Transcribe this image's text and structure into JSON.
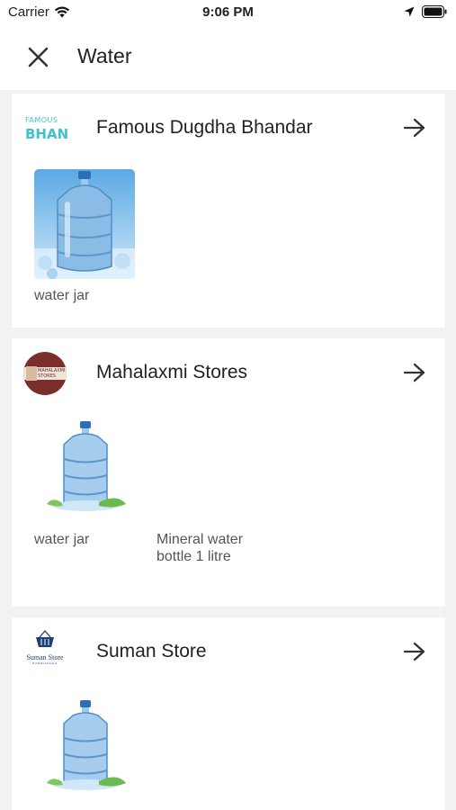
{
  "status_bar": {
    "carrier": "Carrier",
    "time": "9:06 PM"
  },
  "header": {
    "title": "Water"
  },
  "stores": [
    {
      "name": "Famous Dugdha Bhandar",
      "logo": {
        "line1": "FAMOUS",
        "line2": "BHAN"
      },
      "products": [
        {
          "name": "water jar"
        }
      ]
    },
    {
      "name": "Mahalaxmi Stores",
      "logo": {
        "line1": "MAHALAXMI",
        "line2": "STORES"
      },
      "products": [
        {
          "name": "water jar"
        },
        {
          "name": "Mineral water bottle 1 litre"
        }
      ]
    },
    {
      "name": "Suman Store",
      "logo": {
        "line1": "Suman Store",
        "line2": "DARBHANGA"
      },
      "products": [
        {
          "name": ""
        }
      ]
    }
  ],
  "icons": {
    "close": "close-icon",
    "arrow": "arrow-right-icon",
    "wifi": "wifi-icon",
    "location": "location-arrow-icon",
    "battery": "battery-icon"
  },
  "colors": {
    "accent_teal": "#3ec3cf",
    "maha_brown": "#7a2f2a",
    "suman_blue": "#1d3f73",
    "background": "#f2f2f2"
  }
}
